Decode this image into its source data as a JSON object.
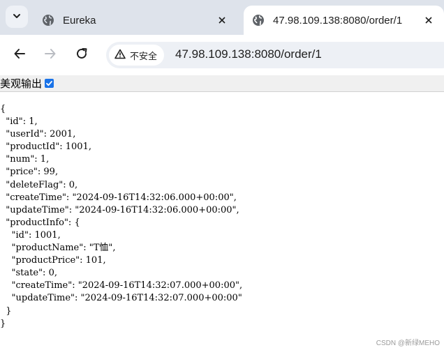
{
  "browser": {
    "tabs": [
      {
        "title": "Eureka",
        "active": false,
        "favicon": "globe-icon"
      },
      {
        "title": "47.98.109.138:8080/order/1",
        "active": true,
        "favicon": "globe-icon"
      }
    ],
    "security_label": "不安全",
    "url": "47.98.109.138:8080/order/1"
  },
  "pretty_print": {
    "label": "美观输出",
    "checked": true
  },
  "json_lines": [
    "{",
    "  \"id\": 1,",
    "  \"userId\": 2001,",
    "  \"productId\": 1001,",
    "  \"num\": 1,",
    "  \"price\": 99,",
    "  \"deleteFlag\": 0,",
    "  \"createTime\": \"2024-09-16T14:32:06.000+00:00\",",
    "  \"updateTime\": \"2024-09-16T14:32:06.000+00:00\",",
    "  \"productInfo\": {",
    "    \"id\": 1001,",
    "    \"productName\": \"T恤\",",
    "    \"productPrice\": 101,",
    "    \"state\": 0,",
    "    \"createTime\": \"2024-09-16T14:32:07.000+00:00\",",
    "    \"updateTime\": \"2024-09-16T14:32:07.000+00:00\"",
    "  }",
    "}"
  ],
  "watermark": "CSDN @新绿MEHO",
  "colors": {
    "tabbar_bg": "#dee3eb",
    "omnibox_bg": "#edf0f5",
    "checkbox_accent": "#1a73e8"
  }
}
